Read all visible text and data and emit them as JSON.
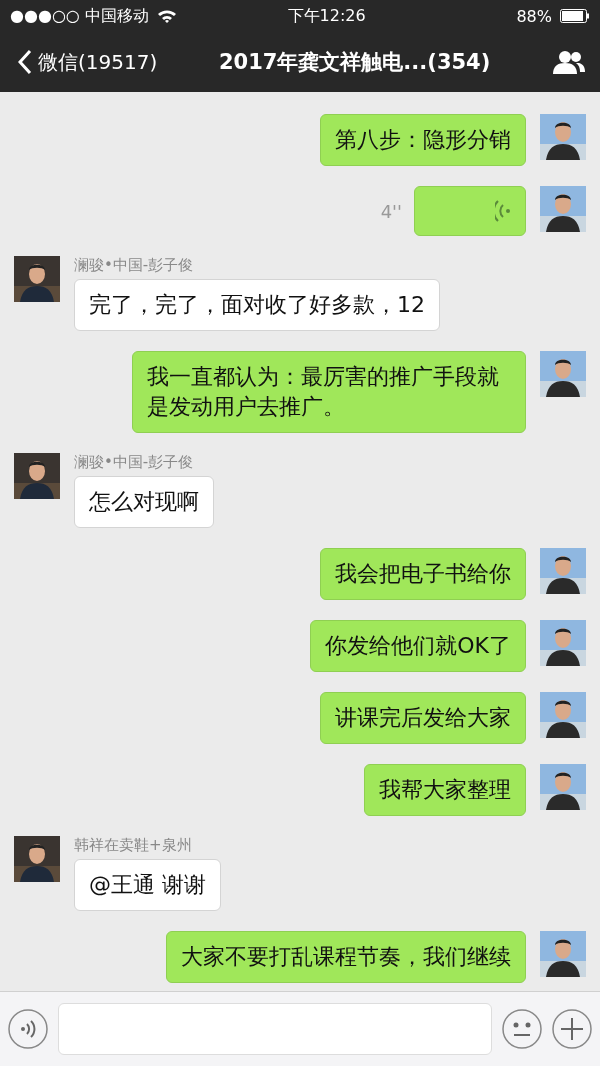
{
  "status_bar": {
    "carrier": "●●●○○ 中国移动",
    "time": "下午12:26",
    "battery": "88%"
  },
  "nav": {
    "back": "微信(19517)",
    "title": "2017年龚文祥触电...(354)"
  },
  "messages": [
    {
      "kind": "text",
      "self": true,
      "text": "第八步：隐形分销"
    },
    {
      "kind": "voice",
      "self": true,
      "duration": "4''"
    },
    {
      "kind": "text",
      "self": false,
      "sender": "澜骏•中国-彭子俊",
      "text": "完了，完了，面对收了好多款，12"
    },
    {
      "kind": "text",
      "self": true,
      "text": "我一直都认为：最厉害的推广手段就是发动用户去推广。"
    },
    {
      "kind": "text",
      "self": false,
      "sender": "澜骏•中国-彭子俊",
      "text": "怎么对现啊"
    },
    {
      "kind": "text",
      "self": true,
      "text": "我会把电子书给你"
    },
    {
      "kind": "text",
      "self": true,
      "text": "你发给他们就OK了"
    },
    {
      "kind": "text",
      "self": true,
      "text": "讲课完后发给大家"
    },
    {
      "kind": "text",
      "self": true,
      "text": "我帮大家整理"
    },
    {
      "kind": "text",
      "self": false,
      "sender": "韩祥在卖鞋+泉州",
      "text": "@王通 谢谢"
    },
    {
      "kind": "text",
      "self": true,
      "text": "大家不要打乱课程节奏，我们继续"
    }
  ]
}
